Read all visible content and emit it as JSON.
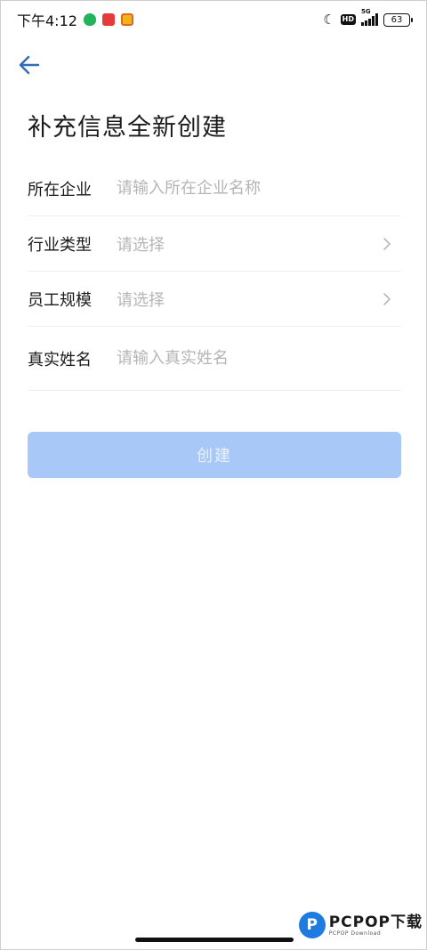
{
  "status_bar": {
    "time": "下午4:12",
    "network": "5G",
    "hd": "HD",
    "battery": "63"
  },
  "page": {
    "title": "补充信息全新创建"
  },
  "form": {
    "company": {
      "label": "所在企业",
      "placeholder": "请输入所在企业名称"
    },
    "industry": {
      "label": "行业类型",
      "placeholder": "请选择"
    },
    "scale": {
      "label": "员工规模",
      "placeholder": "请选择"
    },
    "real_name": {
      "label": "真实姓名",
      "placeholder": "请输入真实姓名"
    }
  },
  "actions": {
    "create_label": "创建"
  },
  "watermark": {
    "logo": "P",
    "title": "PCPOP下载",
    "subtitle": "PCPOP Download"
  },
  "colors": {
    "accent_disabled": "#a8c8f8",
    "back_arrow": "#2f6db5"
  }
}
